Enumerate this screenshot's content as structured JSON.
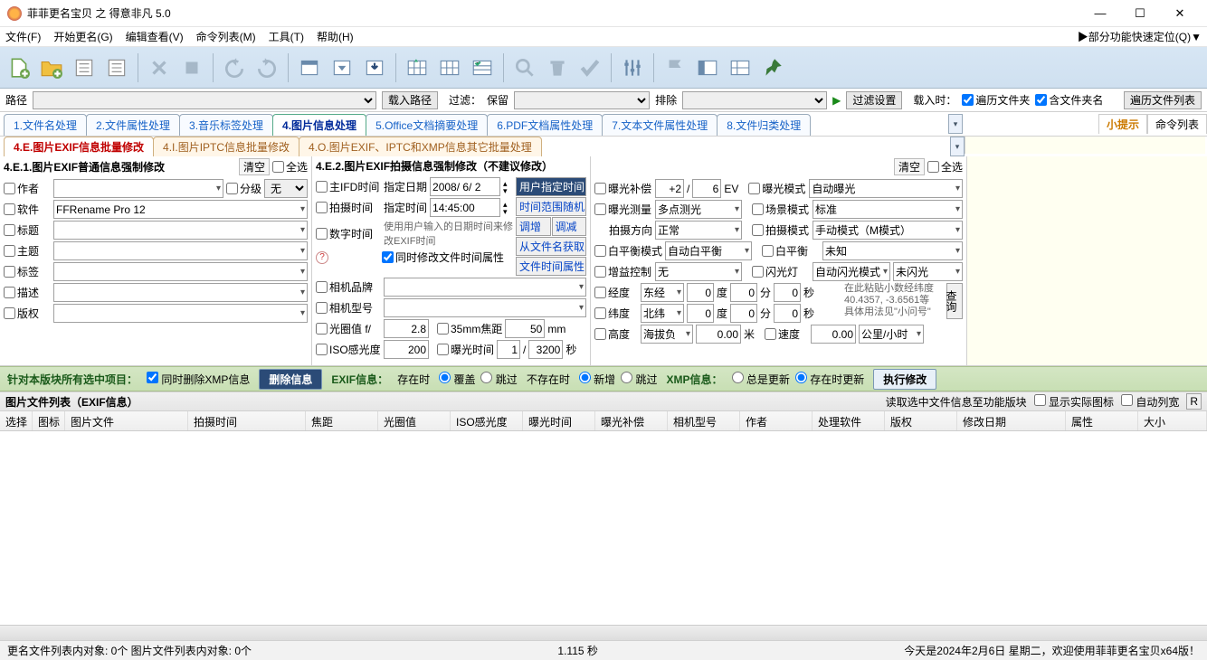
{
  "window": {
    "title": "菲菲更名宝贝 之 得意非凡 5.0"
  },
  "menu": {
    "items": [
      "文件(F)",
      "开始更名(G)",
      "编辑查看(V)",
      "命令列表(M)",
      "工具(T)",
      "帮助(H)"
    ],
    "right": "▶部分功能快速定位(Q)▼"
  },
  "pathbar": {
    "path_label": "路径",
    "load_path_btn": "载入路径",
    "filter_label": "过滤：",
    "keep_label": "保留",
    "exclude_label": "排除",
    "filter_settings_btn": "过滤设置",
    "on_load_label": "载入时：",
    "recursive_label": "遍历文件夹",
    "include_folder_name_label": "含文件夹名",
    "traverse_btn": "遍历文件列表"
  },
  "tabs": {
    "main": [
      "1.文件名处理",
      "2.文件属性处理",
      "3.音乐标签处理",
      "4.图片信息处理",
      "5.Office文档摘要处理",
      "6.PDF文档属性处理",
      "7.文本文件属性处理",
      "8.文件归类处理"
    ],
    "main_active": 3,
    "sub": [
      "4.E.图片EXIF信息批量修改",
      "4.I.图片IPTC信息批量修改",
      "4.O.图片EXIF、IPTC和XMP信息其它批量处理"
    ],
    "sub_active": 0,
    "hint": [
      "小提示",
      "命令列表"
    ],
    "hint_active": 0
  },
  "left_panel": {
    "title": "4.E.1.图片EXIF普通信息强制修改",
    "clear_btn": "清空",
    "select_all": "全选",
    "author": "作者",
    "level_label": "分级",
    "level_value": "无",
    "software": "软件",
    "software_value": "FFRename Pro 12",
    "title_label": "标题",
    "subject": "主题",
    "tags": "标签",
    "description": "描述",
    "copyright": "版权"
  },
  "mid_panel": {
    "title": "4.E.2.图片EXIF拍摄信息强制修改（不建议修改）",
    "main_ifd": "主IFD时间",
    "shoot_time": "拍摄时间",
    "digital_time": "数字时间",
    "fixed_date": "指定日期",
    "fixed_date_value": "2008/ 6/ 2",
    "fixed_time": "指定时间",
    "fixed_time_value": "14:45:00",
    "hint_text": "使用用户输入的日期时间来修改EXIF时间",
    "also_modify_file_time": "同时修改文件时间属性",
    "side": {
      "user_time": "用户指定时间",
      "random": "时间范围随机",
      "up": "调增",
      "down": "调减",
      "from_name": "从文件名获取",
      "file_attr": "文件时间属性"
    },
    "camera_brand": "相机品牌",
    "camera_model": "相机型号",
    "aperture": "光圈值  f/",
    "aperture_value": "2.8",
    "focal35": "35mm焦距",
    "focal35_value": "50",
    "focal35_unit": "mm",
    "iso": "ISO感光度",
    "iso_value": "200",
    "exposure": "曝光时间",
    "exposure_num": "1",
    "exposure_den": "3200",
    "exposure_unit": "秒"
  },
  "right_panel": {
    "clear_btn": "清空",
    "select_all": "全选",
    "ev_comp": "曝光补偿",
    "ev_num": "+2",
    "ev_den": "6",
    "ev_unit": "EV",
    "ev_mode": "曝光模式",
    "ev_mode_value": "自动曝光",
    "metering": "曝光测量",
    "metering_value": "多点测光",
    "scene": "场景模式",
    "scene_value": "标准",
    "orientation": "拍摄方向",
    "orientation_value": "正常",
    "shoot_mode": "拍摄模式",
    "shoot_mode_value": "手动模式（M模式）",
    "wb_mode": "白平衡模式",
    "wb_mode_value": "自动白平衡",
    "wb": "白平衡",
    "wb_value": "未知",
    "gain": "增益控制",
    "gain_value": "无",
    "flash": "闪光灯",
    "flash_value": "自动闪光模式",
    "flash_value2": "未闪光",
    "lon": "经度",
    "lon_ref": "东经",
    "lon_deg": "0",
    "deg_unit": "度",
    "lon_min": "0",
    "min_unit": "分",
    "lon_sec": "0",
    "sec_unit": "秒",
    "paste_hint1": "在此粘贴小数经纬度",
    "paste_hint2": "40.4357, -3.6561等",
    "paste_hint3": "具体用法见\"小问号\"",
    "lookup": "查询",
    "lat": "纬度",
    "lat_ref": "北纬",
    "lat_deg": "0",
    "lat_min": "0",
    "lat_sec": "0",
    "alt": "高度",
    "alt_ref": "海拔负",
    "alt_value": "0.00",
    "alt_unit": "米",
    "speed": "速度",
    "speed_value": "0.00",
    "speed_unit": "公里/小时"
  },
  "bottom_bar": {
    "label": "针对本版块所有选中项目：",
    "also_delete_xmp": "同时删除XMP信息",
    "delete_btn": "删除信息",
    "exif_label": "EXIF信息：",
    "exist_label": "存在时",
    "overwrite": "覆盖",
    "skip": "跳过",
    "not_exist_label": "不存在时",
    "create": "新增",
    "skip2": "跳过",
    "xmp_label": "XMP信息：",
    "always_update": "总是更新",
    "update_on_exist": "存在时更新",
    "execute_btn": "执行修改"
  },
  "list": {
    "title": "图片文件列表（EXIF信息）",
    "read_to_panel": "读取选中文件信息至功能版块",
    "show_icon": "显示实际图标",
    "auto_width": "自动列宽",
    "r_btn": "R",
    "columns": [
      "选择",
      "图标",
      "图片文件",
      "拍摄时间",
      "焦距",
      "光圈值",
      "ISO感光度",
      "曝光时间",
      "曝光补偿",
      "相机型号",
      "作者",
      "处理软件",
      "版权",
      "修改日期",
      "属性",
      "大小"
    ]
  },
  "status": {
    "left": "更名文件列表内对象: 0个   图片文件列表内对象: 0个",
    "mid": "1.115 秒",
    "right": "今天是2024年2月6日  星期二，欢迎使用菲菲更名宝贝x64版！"
  }
}
